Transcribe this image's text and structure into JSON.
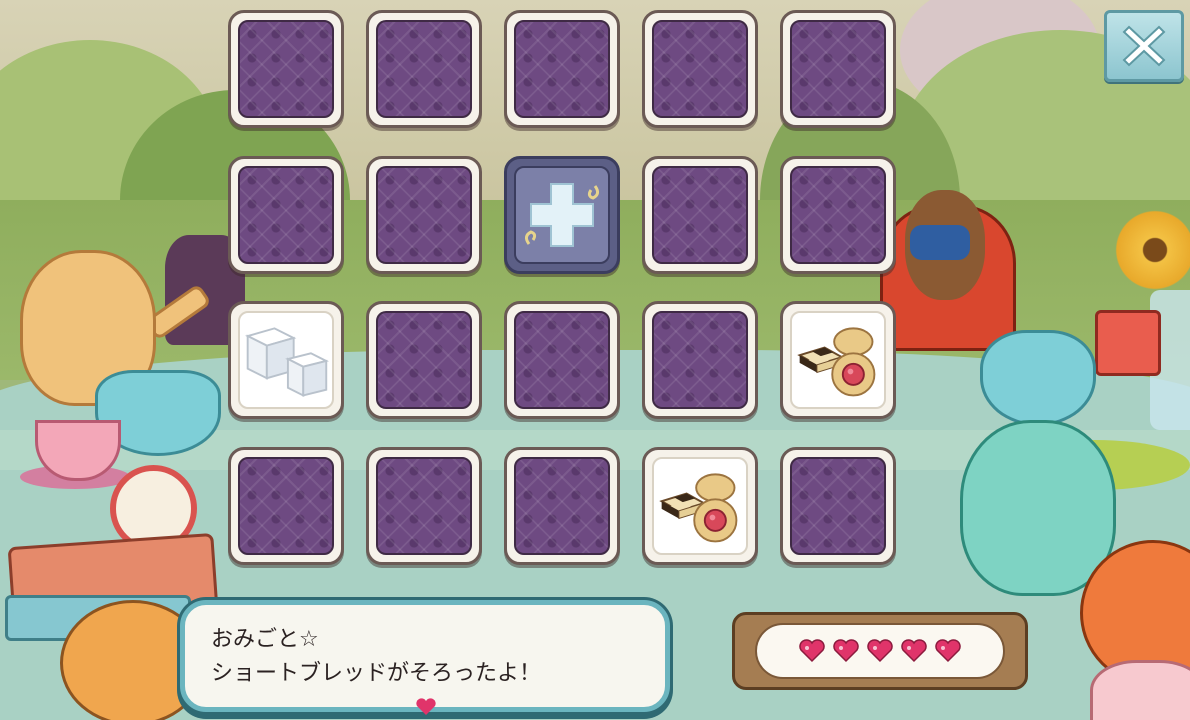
{
  "game": {
    "close_button": {
      "icon": "close-x-icon"
    },
    "grid": {
      "rows": 4,
      "columns": 5,
      "cards": [
        {
          "state": "face-down"
        },
        {
          "state": "face-down"
        },
        {
          "state": "face-down"
        },
        {
          "state": "face-down"
        },
        {
          "state": "face-down"
        },
        {
          "state": "face-down"
        },
        {
          "state": "face-down"
        },
        {
          "state": "special",
          "icon": "plus-icon"
        },
        {
          "state": "face-down"
        },
        {
          "state": "face-down"
        },
        {
          "state": "face-up",
          "icon": "sugar-cubes-icon"
        },
        {
          "state": "face-down"
        },
        {
          "state": "face-down"
        },
        {
          "state": "face-down"
        },
        {
          "state": "face-up",
          "icon": "shortbread-icon"
        },
        {
          "state": "face-down"
        },
        {
          "state": "face-down"
        },
        {
          "state": "face-down"
        },
        {
          "state": "face-up",
          "icon": "shortbread-icon"
        },
        {
          "state": "face-down"
        }
      ]
    },
    "message": {
      "line1": "おみごと☆",
      "line2": "ショートブレッドがそろったよ！"
    },
    "lives": {
      "count": 5,
      "icon": "heart-icon",
      "color": "#e0346a"
    }
  }
}
